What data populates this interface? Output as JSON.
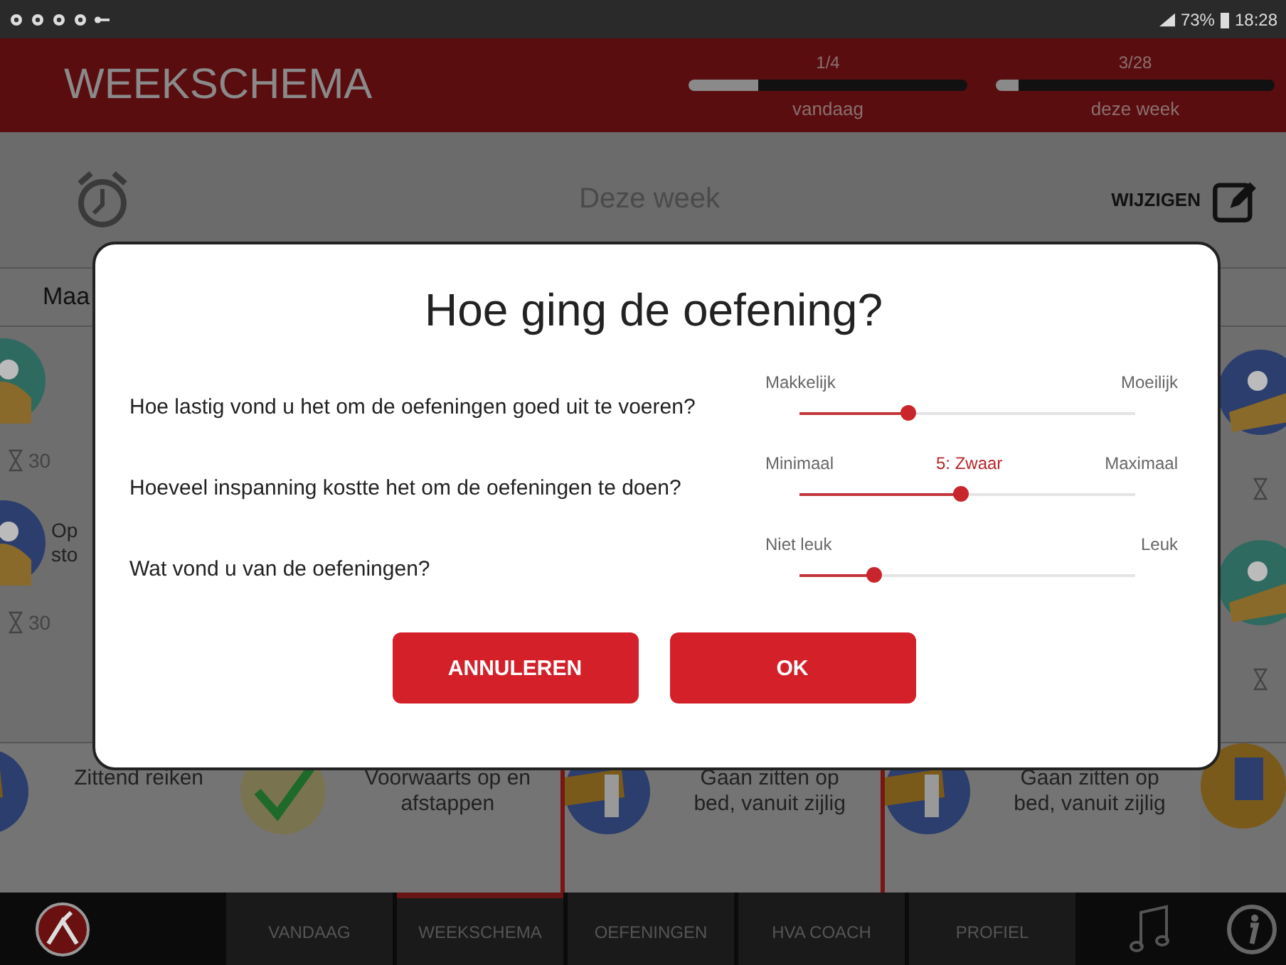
{
  "status_bar": {
    "battery": "73%",
    "time": "18:28"
  },
  "header": {
    "title": "WEEKSCHEMA",
    "progress": [
      {
        "count": "1/4",
        "level": 0.25,
        "label": "vandaag"
      },
      {
        "count": "3/28",
        "level": 0.08,
        "label": "deze week"
      }
    ]
  },
  "toolbar": {
    "heading": "Deze week",
    "edit_button": "WIJZIGEN"
  },
  "day_tab": "Maa",
  "left_column": [
    {
      "duration": "30"
    },
    {
      "lines": [
        "Op",
        "sto"
      ],
      "duration": "30"
    }
  ],
  "cards": [
    {
      "lines": [
        "Zittend reiken"
      ],
      "done": false
    },
    {
      "lines": [
        "Voorwaarts op en",
        "afstappen"
      ],
      "done": true
    },
    {
      "lines": [
        "Gaan zitten op",
        "bed, vanuit zijlig"
      ],
      "done": false
    },
    {
      "lines": [
        "Gaan zitten op",
        "bed, vanuit zijlig"
      ],
      "done": false
    }
  ],
  "dialog": {
    "title": "Hoe ging de oefening?",
    "questions": [
      {
        "text": "Hoe lastig vond u het om de oefeningen goed uit te voeren?",
        "min_label": "Makkelijk",
        "max_label": "Moeilijk",
        "level": 0.32
      },
      {
        "text": "Hoeveel inspanning kostte het om de oefeningen te doen?",
        "min_label": "Minimaal",
        "value_label": "5: Zwaar",
        "max_label": "Maximaal",
        "level": 0.48
      },
      {
        "text": "Wat vond u van de oefeningen?",
        "min_label": "Niet leuk",
        "max_label": "Leuk",
        "level": 0.22
      }
    ],
    "buttons": [
      "ANNULEREN",
      "OK"
    ]
  },
  "nav": {
    "tabs": [
      {
        "label": "VANDAAG",
        "selected": false
      },
      {
        "label": "WEEKSCHEMA",
        "selected": true
      },
      {
        "label": "OEFENINGEN",
        "selected": false
      },
      {
        "label": "HVA COACH",
        "selected": false
      },
      {
        "label": "PROFIEL",
        "selected": false
      }
    ]
  }
}
